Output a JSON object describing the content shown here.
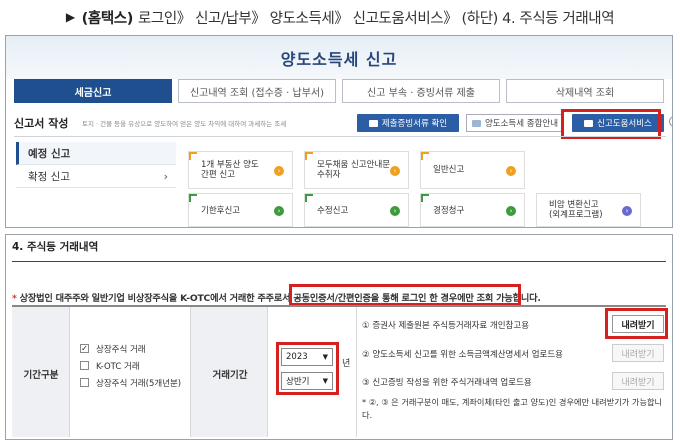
{
  "caption": {
    "prefix": "▶",
    "bold": "(홈택스)",
    "rest": "로그인》 신고/납부》 양도소득세》 신고도움서비스》 (하단) 4. 주식등 거래내역"
  },
  "page1": {
    "title": "양도소득세  신고",
    "tabs": [
      "세금신고",
      "신고내역 조회 (접수증 · 납부서)",
      "신고 부속 · 증빙서류 제출",
      "삭제내역 조회"
    ],
    "report_label": "신고서 작성",
    "report_desc": "토지 · 건물 등을 유상으로 양도하여 얻은 양도 차익에 대하여 과세하는 조세",
    "btn_evidence": "제출증빙서류 확인",
    "btn_guide": "양도소득세 종합안내",
    "btn_help_service": "신고도움서비스",
    "help_icon": "?",
    "sidebar": [
      {
        "label": "예정 신고"
      },
      {
        "label": "확정 신고",
        "chevron": "›"
      }
    ],
    "cards": [
      {
        "text": "1개 부동산 양도\n간편 신고",
        "color": "orange"
      },
      {
        "text": "모두채움 신고안내문\n수취자",
        "color": "orange"
      },
      {
        "text": "일반신고",
        "color": "orange"
      },
      {
        "text": "기한후신고",
        "color": "green"
      },
      {
        "text": "수정신고",
        "color": "green"
      },
      {
        "text": "경정청구",
        "color": "green"
      },
      {
        "text": "비암 변환신고\n(외계프로그램)",
        "color": "purple"
      }
    ],
    "card_arrow": "›"
  },
  "page2": {
    "section_title": "4. 주식등 거래내역",
    "notice_star": "*",
    "notice": "상장법인 대주주와 일반기업 비상장주식을 K-OTC에서 거래한 주주로서 공동인증서/간편인증을 통해 로그인 한 경우에만 조회 가능합니다.",
    "period_type_label": "기간구분",
    "checkboxes": [
      {
        "label": "상장주식 거래",
        "checked": true,
        "mark": "✓"
      },
      {
        "label": "K-OTC 거래",
        "checked": false,
        "mark": ""
      },
      {
        "label": "상장주식 거래(5개년분)",
        "checked": false,
        "mark": ""
      }
    ],
    "trade_period_label": "거래기간",
    "year_value": "2023",
    "year_unit": "년",
    "half_value": "상반기",
    "select_arrow": "▼",
    "options": [
      {
        "text": "① 증권사 제출원본 주식등거래자료 개인참고용",
        "button": "내려받기",
        "enabled": true
      },
      {
        "text": "② 양도소득세 신고를 위한 소득금액계산명세서 업로드용",
        "button": "내려받기",
        "enabled": false
      },
      {
        "text": "③ 신고증빙 작성을 위한 주식거래내역 업로드용",
        "button": "내려받기",
        "enabled": false
      }
    ],
    "footnote": "* ②, ③ 은 거래구분이 매도, 계좌이체(타인 출고 양도)인 경우에만 내려받기가 가능합니다."
  }
}
